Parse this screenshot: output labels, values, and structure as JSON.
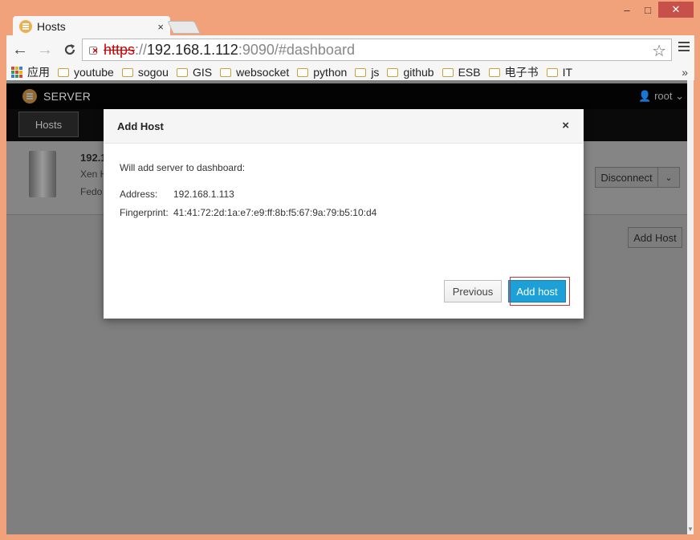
{
  "window": {
    "controls": {
      "minimize": "–",
      "maximize": "□",
      "close": "✕"
    }
  },
  "tab": {
    "title": "Hosts",
    "close_glyph": "×"
  },
  "toolbar": {
    "back_glyph": "←",
    "forward_glyph": "→",
    "reload_glyph": "C",
    "url_scheme": "https",
    "url_sep": "://",
    "url_host": "192.168.1.112",
    "url_rest": ":9090/#dashboard",
    "star_glyph": "☆"
  },
  "bookmarks": {
    "apps_label": "应用",
    "items": [
      "youtube",
      "sogou",
      "GIS",
      "websocket",
      "python",
      "js",
      "github",
      "ESB",
      "电子书",
      "IT"
    ],
    "more_glyph": "»"
  },
  "page": {
    "brand": "SERVER",
    "user": "root",
    "user_caret": "⌄",
    "hosts_tab": "Hosts",
    "host": {
      "name": "192.1",
      "line2": "Xen H",
      "line3": "Fedo"
    },
    "disconnect_label": "Disconnect",
    "disconnect_caret": "⌄",
    "add_host_label": "Add Host"
  },
  "modal": {
    "title": "Add Host",
    "close_glyph": "×",
    "intro": "Will add server to dashboard:",
    "address_label": "Address:",
    "address_value": "192.168.1.113",
    "fingerprint_label": "Fingerprint:",
    "fingerprint_value": "41:41:72:2d:1a:e7:e9:ff:8b:f5:67:9a:79:b5:10:d4",
    "previous_label": "Previous",
    "add_host_label": "Add host"
  },
  "scrollbar": {
    "down_glyph": "▼"
  },
  "colors": {
    "window_frame": "#f2a27a",
    "primary_button": "#1da0d8",
    "highlight_outline": "#c43a3a",
    "brand_icon": "#f0ad4e",
    "folder_icon": "#c8a23c"
  }
}
